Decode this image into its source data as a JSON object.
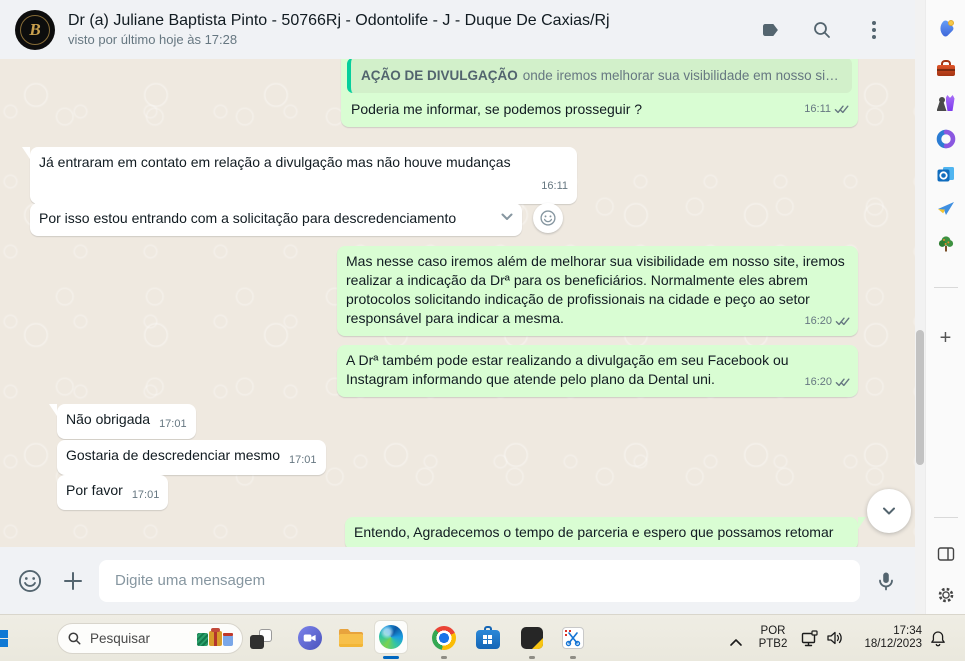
{
  "colors": {
    "outgoing_bubble": "#d9fdd3",
    "incoming_bubble": "#ffffff",
    "quote_accent": "#06cf9c",
    "header_bg": "#f0f2f5",
    "chat_bg": "#efe9e0",
    "icon_gray": "#54656f",
    "edge_active_indicator": "#0067c0"
  },
  "header": {
    "title": "Dr (a) Juliane Baptista Pinto - 50766Rj - Odontolife - J - Duque De Caxias/Rj",
    "subtitle": "visto por último hoje às 17:28",
    "avatar_monogram": "B",
    "icons": [
      "label-icon",
      "search-icon",
      "kebab-menu-icon"
    ]
  },
  "chat": {
    "messages": [
      {
        "direction": "outgoing",
        "quote": {
          "title": "AÇÃO DE DIVULGAÇÃO",
          "text": "onde iremos melhorar sua visibilidade em nosso site de..."
        },
        "text": "Poderia me informar, se podemos prosseguir ?",
        "time": "16:11",
        "status": "double-check"
      },
      {
        "direction": "incoming",
        "text": "Já entraram em contato em relação a divulgação mas não houve mudanças",
        "time": "16:11"
      },
      {
        "direction": "incoming",
        "text": "Por isso estou entrando com a solicitação para descredenciamento",
        "has_dropdown": true,
        "has_react_button": true
      },
      {
        "direction": "outgoing",
        "text": "Mas nesse caso iremos além de melhorar sua visibilidade em nosso site, iremos realizar a indicação da Drª para os beneficiários. Normalmente eles abrem protocolos solicitando indicação de profissionais na cidade e peço ao setor responsável para indicar a mesma.",
        "time": "16:20",
        "status": "double-check"
      },
      {
        "direction": "outgoing",
        "text": "A Drª também pode estar realizando a divulgação em seu Facebook ou Instagram informando que atende pelo plano da Dental uni.",
        "time": "16:20",
        "status": "double-check"
      },
      {
        "direction": "incoming",
        "text": "Não obrigada",
        "time": "17:01"
      },
      {
        "direction": "incoming",
        "text": "Gostaria de descredenciar mesmo",
        "time": "17:01"
      },
      {
        "direction": "incoming",
        "text": "Por favor",
        "time": "17:01"
      },
      {
        "direction": "outgoing",
        "partial": true,
        "text": "Entendo, Agradecemos o tempo de parceria e espero que possamos retomar"
      }
    ]
  },
  "composer": {
    "placeholder": "Digite uma mensagem",
    "icons": [
      "emoji-icon",
      "plus-icon",
      "mic-icon"
    ]
  },
  "edge_sidebar": {
    "items": [
      "shopping",
      "toolbox",
      "games",
      "microsoft-365",
      "outlook",
      "send",
      "tree",
      "add"
    ],
    "bottom_items": [
      "panel",
      "settings"
    ]
  },
  "taskbar": {
    "search_label": "Pesquisar",
    "apps": [
      "start",
      "task-view",
      "chat",
      "file-explorer",
      "edge",
      "chrome",
      "store",
      "dark-app",
      "snipping-tool"
    ],
    "tray": {
      "language_top": "POR",
      "language_bottom": "PTB2",
      "time": "17:34",
      "date": "18/12/2023"
    }
  }
}
